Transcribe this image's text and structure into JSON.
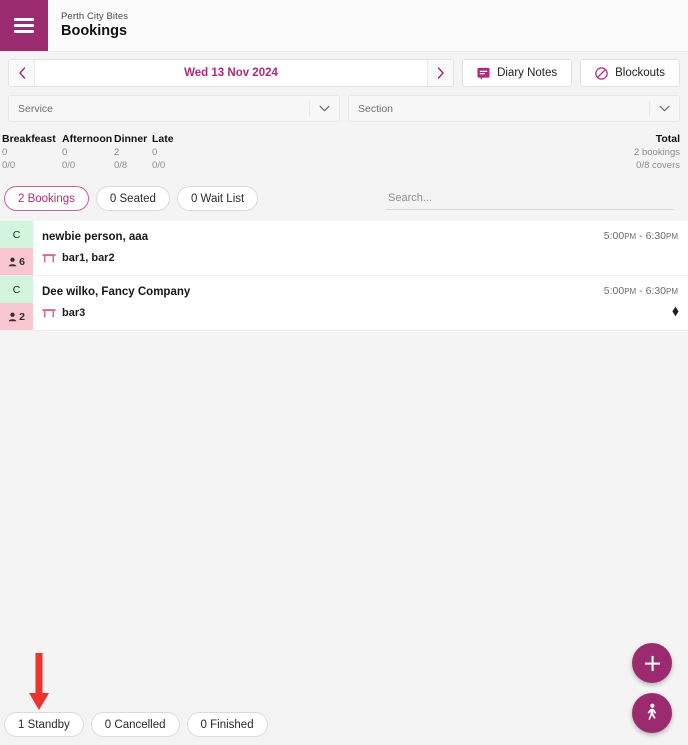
{
  "header": {
    "menu_icon": "hamburger-menu-icon",
    "venue_name": "Perth City Bites",
    "page_title": "Bookings",
    "brand_color": "#9c2a6f"
  },
  "toolbar": {
    "prev_icon": "chevron-left-icon",
    "next_icon": "chevron-right-icon",
    "date_label": "Wed 13 Nov 2024",
    "diary_notes_label": "Diary Notes",
    "diary_notes_icon": "message-note-icon",
    "blockouts_label": "Blockouts",
    "blockouts_icon": "circle-slash-icon"
  },
  "filters": {
    "service": {
      "label": "Service",
      "value": "",
      "arrow_icon": "chevron-down-icon"
    },
    "section": {
      "label": "Section",
      "value": "",
      "arrow_icon": "chevron-down-icon"
    }
  },
  "stats": {
    "services": [
      {
        "name": "Breakfeast",
        "bookings": "0",
        "covers": "0/0"
      },
      {
        "name": "Afternoon",
        "bookings": "0",
        "covers": "0/0"
      },
      {
        "name": "Dinner",
        "bookings": "2",
        "covers": "0/8"
      },
      {
        "name": "Late",
        "bookings": "0",
        "covers": "0/0"
      }
    ],
    "total": {
      "name": "Total",
      "bookings": "2 bookings",
      "covers": "0/8 covers"
    }
  },
  "tabs": {
    "top": [
      {
        "label": "2 Bookings",
        "active": true
      },
      {
        "label": "0 Seated",
        "active": false
      },
      {
        "label": "0 Wait List",
        "active": false
      }
    ],
    "bottom": [
      {
        "label": "1 Standby",
        "active": false
      },
      {
        "label": "0 Cancelled",
        "active": false
      },
      {
        "label": "0 Finished",
        "active": false
      }
    ]
  },
  "search": {
    "placeholder": "Search...",
    "value": ""
  },
  "bookings": [
    {
      "status_letter": "C",
      "covers": "6",
      "covers_icon": "person-icon",
      "name": "newbie person, aaa",
      "table_icon": "table-icon",
      "tables": "bar1, bar2",
      "time_start": "5:00",
      "time_start_ampm": "PM",
      "time_end": "6:30",
      "time_end_ampm": "PM",
      "flag_icon": ""
    },
    {
      "status_letter": "C",
      "covers": "2",
      "covers_icon": "person-icon",
      "name": "Dee wilko, Fancy Company",
      "table_icon": "table-icon",
      "tables": "bar3",
      "time_start": "5:00",
      "time_start_ampm": "PM",
      "time_end": "6:30",
      "time_end_ampm": "PM",
      "flag_icon": "diamond-flag-icon"
    }
  ],
  "actions": {
    "add_label": "+",
    "add_icon": "plus-icon",
    "walkin_icon": "walking-person-icon"
  },
  "annotation": {
    "arrow_icon": "down-arrow-annotation",
    "color": "#f0322c"
  },
  "colors": {
    "accent": "#b02a7c",
    "brand": "#9c2a6f",
    "status_badge_bg": "#d3f4dd",
    "covers_badge_bg": "#f8c7cf",
    "page_bg": "#f4f4f5"
  }
}
